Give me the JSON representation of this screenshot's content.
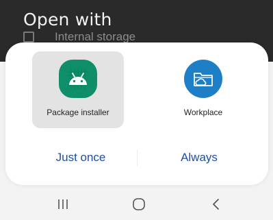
{
  "background": {
    "title": "Open with",
    "row_label": "Internal storage"
  },
  "sheet": {
    "apps": [
      {
        "label": "Package installer",
        "icon": "android-icon",
        "selected": true,
        "color": "#0e8f6a"
      },
      {
        "label": "Workplace",
        "icon": "folder-cloud-icon",
        "selected": false,
        "color": "#1e7fc6"
      }
    ],
    "actions": {
      "just_once": "Just once",
      "always": "Always"
    }
  },
  "navbar": {
    "recents": "recents-icon",
    "home": "home-icon",
    "back": "back-icon"
  },
  "colors": {
    "accent": "#1d4f9c",
    "selected_tile": "#e3e3e3",
    "sheet_bg": "#ffffff",
    "dim_bg": "#2a2a2a"
  }
}
